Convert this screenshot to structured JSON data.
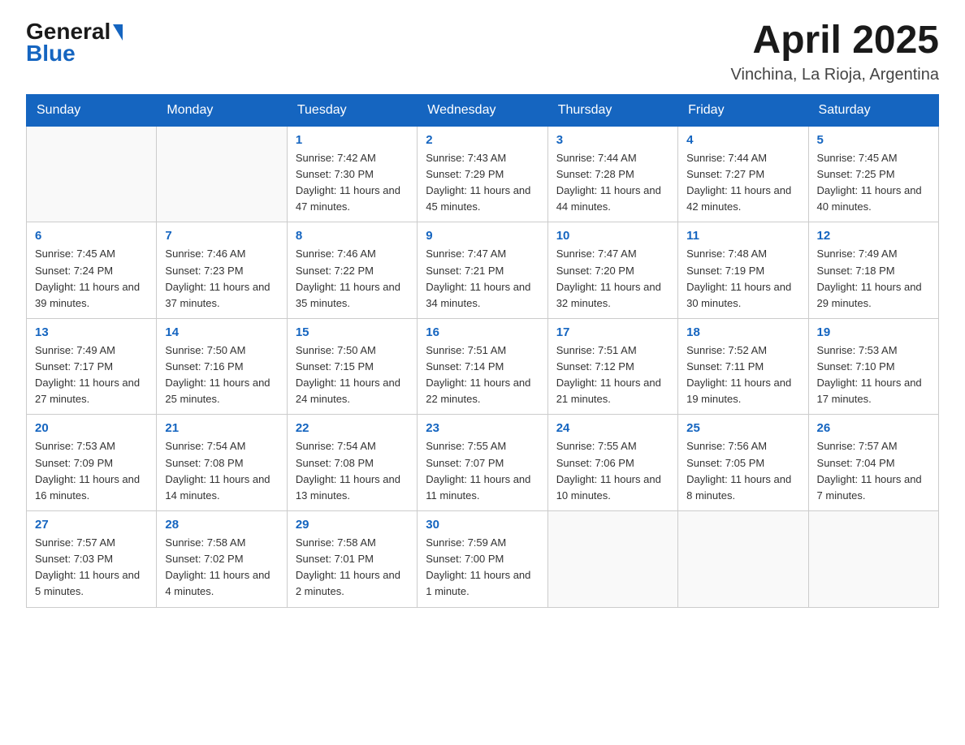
{
  "header": {
    "logo_general": "General",
    "logo_blue": "Blue",
    "title": "April 2025",
    "subtitle": "Vinchina, La Rioja, Argentina"
  },
  "weekdays": [
    "Sunday",
    "Monday",
    "Tuesday",
    "Wednesday",
    "Thursday",
    "Friday",
    "Saturday"
  ],
  "weeks": [
    [
      {
        "day": "",
        "sunrise": "",
        "sunset": "",
        "daylight": ""
      },
      {
        "day": "",
        "sunrise": "",
        "sunset": "",
        "daylight": ""
      },
      {
        "day": "1",
        "sunrise": "Sunrise: 7:42 AM",
        "sunset": "Sunset: 7:30 PM",
        "daylight": "Daylight: 11 hours and 47 minutes."
      },
      {
        "day": "2",
        "sunrise": "Sunrise: 7:43 AM",
        "sunset": "Sunset: 7:29 PM",
        "daylight": "Daylight: 11 hours and 45 minutes."
      },
      {
        "day": "3",
        "sunrise": "Sunrise: 7:44 AM",
        "sunset": "Sunset: 7:28 PM",
        "daylight": "Daylight: 11 hours and 44 minutes."
      },
      {
        "day": "4",
        "sunrise": "Sunrise: 7:44 AM",
        "sunset": "Sunset: 7:27 PM",
        "daylight": "Daylight: 11 hours and 42 minutes."
      },
      {
        "day": "5",
        "sunrise": "Sunrise: 7:45 AM",
        "sunset": "Sunset: 7:25 PM",
        "daylight": "Daylight: 11 hours and 40 minutes."
      }
    ],
    [
      {
        "day": "6",
        "sunrise": "Sunrise: 7:45 AM",
        "sunset": "Sunset: 7:24 PM",
        "daylight": "Daylight: 11 hours and 39 minutes."
      },
      {
        "day": "7",
        "sunrise": "Sunrise: 7:46 AM",
        "sunset": "Sunset: 7:23 PM",
        "daylight": "Daylight: 11 hours and 37 minutes."
      },
      {
        "day": "8",
        "sunrise": "Sunrise: 7:46 AM",
        "sunset": "Sunset: 7:22 PM",
        "daylight": "Daylight: 11 hours and 35 minutes."
      },
      {
        "day": "9",
        "sunrise": "Sunrise: 7:47 AM",
        "sunset": "Sunset: 7:21 PM",
        "daylight": "Daylight: 11 hours and 34 minutes."
      },
      {
        "day": "10",
        "sunrise": "Sunrise: 7:47 AM",
        "sunset": "Sunset: 7:20 PM",
        "daylight": "Daylight: 11 hours and 32 minutes."
      },
      {
        "day": "11",
        "sunrise": "Sunrise: 7:48 AM",
        "sunset": "Sunset: 7:19 PM",
        "daylight": "Daylight: 11 hours and 30 minutes."
      },
      {
        "day": "12",
        "sunrise": "Sunrise: 7:49 AM",
        "sunset": "Sunset: 7:18 PM",
        "daylight": "Daylight: 11 hours and 29 minutes."
      }
    ],
    [
      {
        "day": "13",
        "sunrise": "Sunrise: 7:49 AM",
        "sunset": "Sunset: 7:17 PM",
        "daylight": "Daylight: 11 hours and 27 minutes."
      },
      {
        "day": "14",
        "sunrise": "Sunrise: 7:50 AM",
        "sunset": "Sunset: 7:16 PM",
        "daylight": "Daylight: 11 hours and 25 minutes."
      },
      {
        "day": "15",
        "sunrise": "Sunrise: 7:50 AM",
        "sunset": "Sunset: 7:15 PM",
        "daylight": "Daylight: 11 hours and 24 minutes."
      },
      {
        "day": "16",
        "sunrise": "Sunrise: 7:51 AM",
        "sunset": "Sunset: 7:14 PM",
        "daylight": "Daylight: 11 hours and 22 minutes."
      },
      {
        "day": "17",
        "sunrise": "Sunrise: 7:51 AM",
        "sunset": "Sunset: 7:12 PM",
        "daylight": "Daylight: 11 hours and 21 minutes."
      },
      {
        "day": "18",
        "sunrise": "Sunrise: 7:52 AM",
        "sunset": "Sunset: 7:11 PM",
        "daylight": "Daylight: 11 hours and 19 minutes."
      },
      {
        "day": "19",
        "sunrise": "Sunrise: 7:53 AM",
        "sunset": "Sunset: 7:10 PM",
        "daylight": "Daylight: 11 hours and 17 minutes."
      }
    ],
    [
      {
        "day": "20",
        "sunrise": "Sunrise: 7:53 AM",
        "sunset": "Sunset: 7:09 PM",
        "daylight": "Daylight: 11 hours and 16 minutes."
      },
      {
        "day": "21",
        "sunrise": "Sunrise: 7:54 AM",
        "sunset": "Sunset: 7:08 PM",
        "daylight": "Daylight: 11 hours and 14 minutes."
      },
      {
        "day": "22",
        "sunrise": "Sunrise: 7:54 AM",
        "sunset": "Sunset: 7:08 PM",
        "daylight": "Daylight: 11 hours and 13 minutes."
      },
      {
        "day": "23",
        "sunrise": "Sunrise: 7:55 AM",
        "sunset": "Sunset: 7:07 PM",
        "daylight": "Daylight: 11 hours and 11 minutes."
      },
      {
        "day": "24",
        "sunrise": "Sunrise: 7:55 AM",
        "sunset": "Sunset: 7:06 PM",
        "daylight": "Daylight: 11 hours and 10 minutes."
      },
      {
        "day": "25",
        "sunrise": "Sunrise: 7:56 AM",
        "sunset": "Sunset: 7:05 PM",
        "daylight": "Daylight: 11 hours and 8 minutes."
      },
      {
        "day": "26",
        "sunrise": "Sunrise: 7:57 AM",
        "sunset": "Sunset: 7:04 PM",
        "daylight": "Daylight: 11 hours and 7 minutes."
      }
    ],
    [
      {
        "day": "27",
        "sunrise": "Sunrise: 7:57 AM",
        "sunset": "Sunset: 7:03 PM",
        "daylight": "Daylight: 11 hours and 5 minutes."
      },
      {
        "day": "28",
        "sunrise": "Sunrise: 7:58 AM",
        "sunset": "Sunset: 7:02 PM",
        "daylight": "Daylight: 11 hours and 4 minutes."
      },
      {
        "day": "29",
        "sunrise": "Sunrise: 7:58 AM",
        "sunset": "Sunset: 7:01 PM",
        "daylight": "Daylight: 11 hours and 2 minutes."
      },
      {
        "day": "30",
        "sunrise": "Sunrise: 7:59 AM",
        "sunset": "Sunset: 7:00 PM",
        "daylight": "Daylight: 11 hours and 1 minute."
      },
      {
        "day": "",
        "sunrise": "",
        "sunset": "",
        "daylight": ""
      },
      {
        "day": "",
        "sunrise": "",
        "sunset": "",
        "daylight": ""
      },
      {
        "day": "",
        "sunrise": "",
        "sunset": "",
        "daylight": ""
      }
    ]
  ]
}
